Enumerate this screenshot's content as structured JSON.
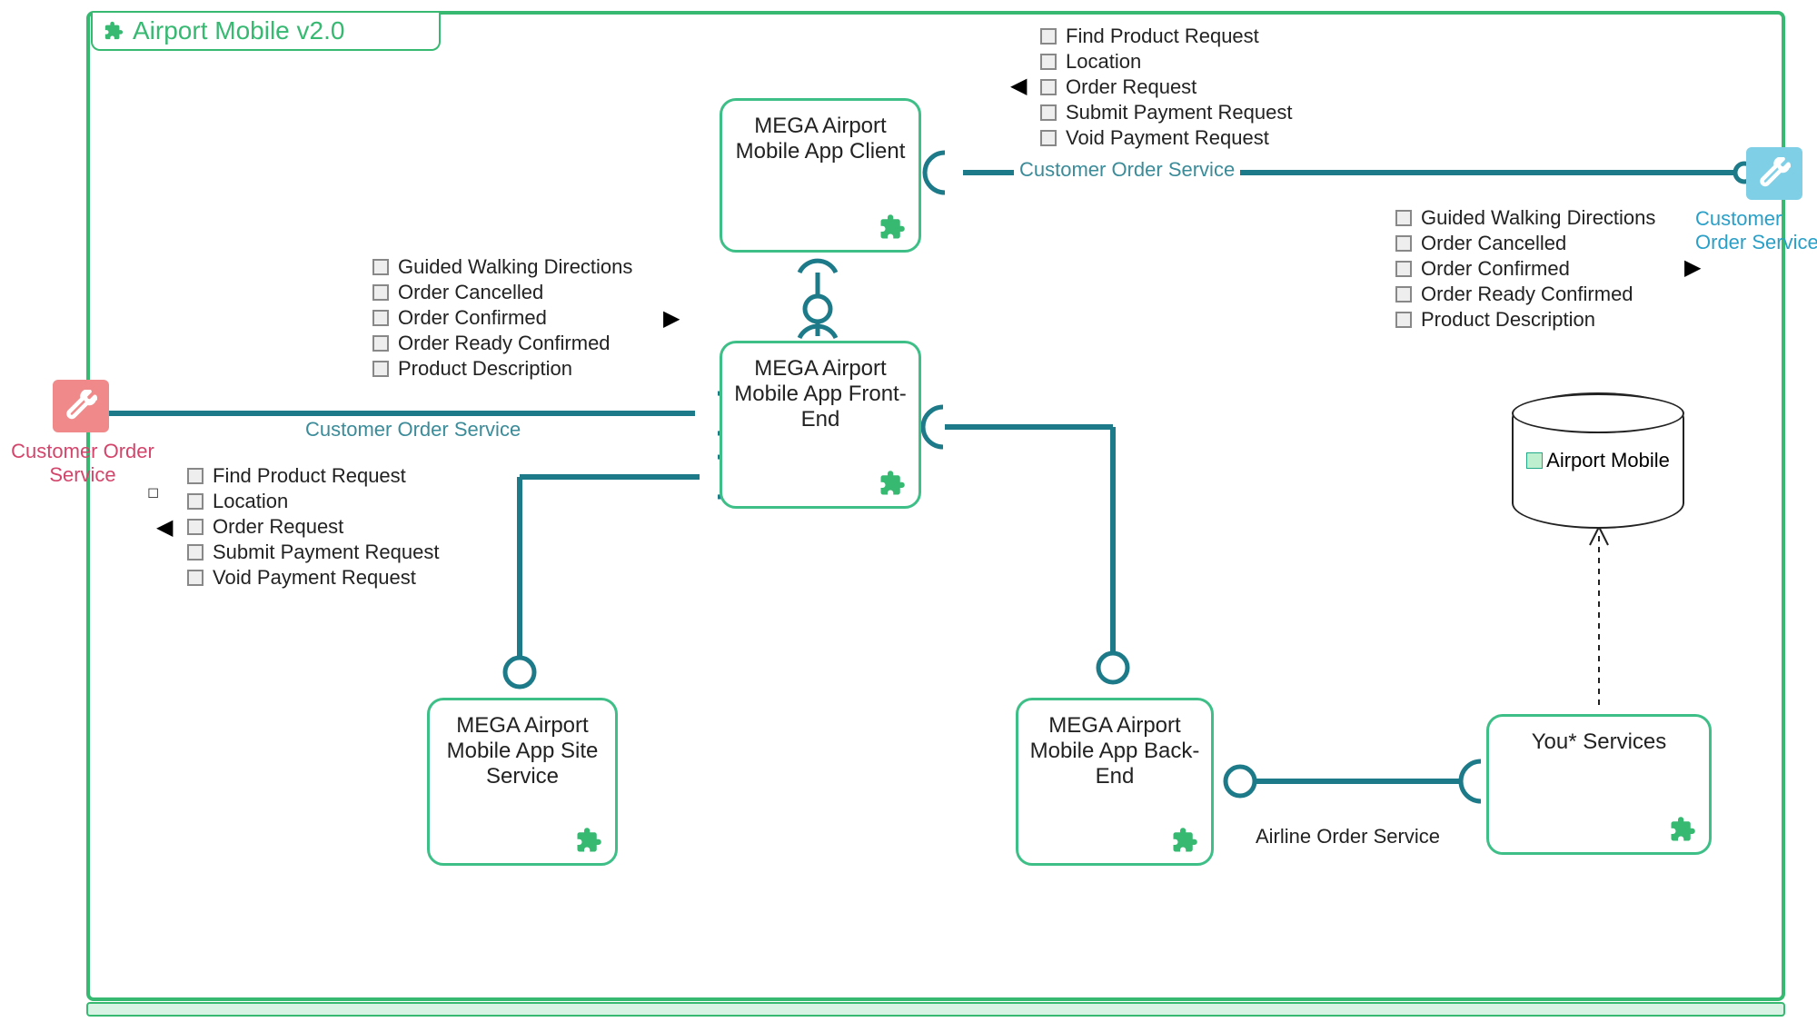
{
  "title": "Airport Mobile v2.0",
  "nodes": {
    "client": "MEGA Airport Mobile App Client",
    "frontend": "MEGA Airport Mobile App Front-End",
    "site": "MEGA Airport Mobile App Site Service",
    "backend": "MEGA Airport Mobile App Back-End",
    "you": "You* Services",
    "db": "Airport Mobile"
  },
  "interfaces": {
    "left_label": "Customer Order Service",
    "right_label": "Customer Order Service"
  },
  "connectors": {
    "top": "Customer Order Service",
    "left": "Customer Order Service",
    "airline": "Airline Order Service"
  },
  "messages": {
    "requests": [
      "Find Product Request",
      "Location",
      "Order Request",
      "Submit Payment Request",
      "Void Payment Request"
    ],
    "responses": [
      "Guided Walking Directions",
      "Order Cancelled",
      "Order Confirmed",
      "Order Ready Confirmed",
      "Product Description"
    ]
  }
}
